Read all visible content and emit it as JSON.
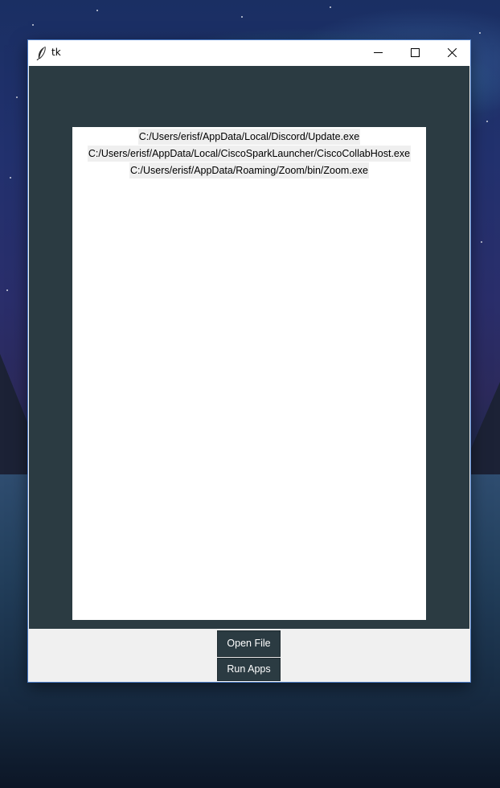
{
  "window": {
    "title": "tk"
  },
  "file_list": [
    "C:/Users/erisf/AppData/Local/Discord/Update.exe",
    "C:/Users/erisf/AppData/Local/CiscoSparkLauncher/CiscoCollabHost.exe",
    "C:/Users/erisf/AppData/Roaming/Zoom/bin/Zoom.exe"
  ],
  "buttons": {
    "open_file": "Open File",
    "run_apps": "Run Apps"
  },
  "colors": {
    "frame_background": "#2b3b42",
    "button_background": "#2b3b42",
    "button_text": "#ffffff",
    "panel_background": "#ffffff",
    "label_background": "#efefef"
  },
  "icons": {
    "app_icon": "tk-feather-icon",
    "minimize": "minimize-icon",
    "maximize": "maximize-icon",
    "close": "close-icon"
  }
}
